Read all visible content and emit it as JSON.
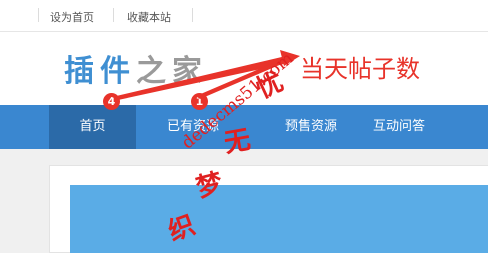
{
  "topbar": {
    "links": [
      "设为首页",
      "收藏本站"
    ]
  },
  "header": {
    "logo_part1": "插件",
    "logo_part2": "之家"
  },
  "annotation": {
    "text": "当天帖子数"
  },
  "nav": {
    "items": [
      {
        "label": "首页",
        "active": true
      },
      {
        "label": "已有资源",
        "active": false
      },
      {
        "label": "预售资源",
        "active": false
      },
      {
        "label": "互动问答",
        "active": false
      }
    ],
    "badges": [
      "4",
      "1"
    ]
  },
  "watermark": {
    "text": "织梦无忧",
    "url": "dedecms51.com"
  },
  "colors": {
    "nav_bg": "#3a87d0",
    "nav_active": "#2b6aa8",
    "badge": "#e8332a",
    "annotation": "#e8332a",
    "logo_blue": "#3f8fd2",
    "logo_gray": "#9a9a9a",
    "banner": "#5aace6"
  }
}
